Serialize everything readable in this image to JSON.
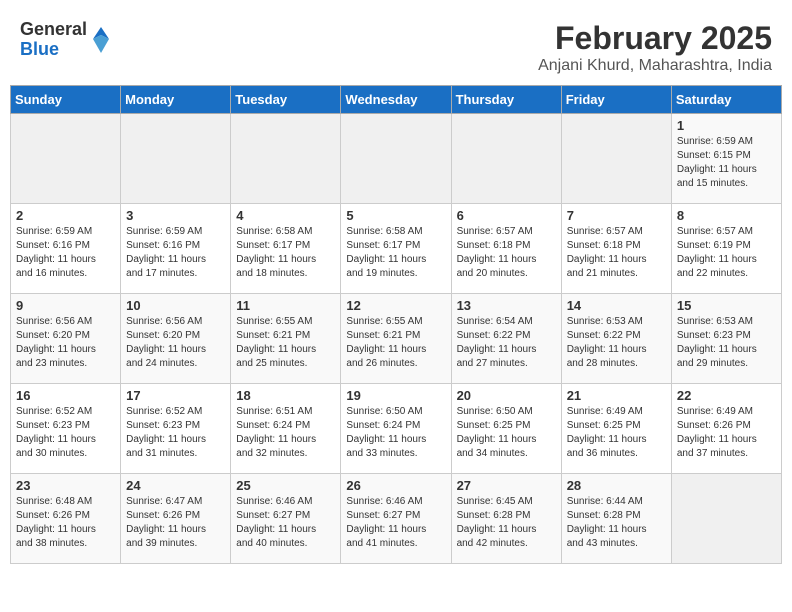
{
  "header": {
    "logo": {
      "general": "General",
      "blue": "Blue"
    },
    "title": "February 2025",
    "subtitle": "Anjani Khurd, Maharashtra, India"
  },
  "weekdays": [
    "Sunday",
    "Monday",
    "Tuesday",
    "Wednesday",
    "Thursday",
    "Friday",
    "Saturday"
  ],
  "weeks": [
    [
      {
        "day": "",
        "info": ""
      },
      {
        "day": "",
        "info": ""
      },
      {
        "day": "",
        "info": ""
      },
      {
        "day": "",
        "info": ""
      },
      {
        "day": "",
        "info": ""
      },
      {
        "day": "",
        "info": ""
      },
      {
        "day": "1",
        "info": "Sunrise: 6:59 AM\nSunset: 6:15 PM\nDaylight: 11 hours\nand 15 minutes."
      }
    ],
    [
      {
        "day": "2",
        "info": "Sunrise: 6:59 AM\nSunset: 6:16 PM\nDaylight: 11 hours\nand 16 minutes."
      },
      {
        "day": "3",
        "info": "Sunrise: 6:59 AM\nSunset: 6:16 PM\nDaylight: 11 hours\nand 17 minutes."
      },
      {
        "day": "4",
        "info": "Sunrise: 6:58 AM\nSunset: 6:17 PM\nDaylight: 11 hours\nand 18 minutes."
      },
      {
        "day": "5",
        "info": "Sunrise: 6:58 AM\nSunset: 6:17 PM\nDaylight: 11 hours\nand 19 minutes."
      },
      {
        "day": "6",
        "info": "Sunrise: 6:57 AM\nSunset: 6:18 PM\nDaylight: 11 hours\nand 20 minutes."
      },
      {
        "day": "7",
        "info": "Sunrise: 6:57 AM\nSunset: 6:18 PM\nDaylight: 11 hours\nand 21 minutes."
      },
      {
        "day": "8",
        "info": "Sunrise: 6:57 AM\nSunset: 6:19 PM\nDaylight: 11 hours\nand 22 minutes."
      }
    ],
    [
      {
        "day": "9",
        "info": "Sunrise: 6:56 AM\nSunset: 6:20 PM\nDaylight: 11 hours\nand 23 minutes."
      },
      {
        "day": "10",
        "info": "Sunrise: 6:56 AM\nSunset: 6:20 PM\nDaylight: 11 hours\nand 24 minutes."
      },
      {
        "day": "11",
        "info": "Sunrise: 6:55 AM\nSunset: 6:21 PM\nDaylight: 11 hours\nand 25 minutes."
      },
      {
        "day": "12",
        "info": "Sunrise: 6:55 AM\nSunset: 6:21 PM\nDaylight: 11 hours\nand 26 minutes."
      },
      {
        "day": "13",
        "info": "Sunrise: 6:54 AM\nSunset: 6:22 PM\nDaylight: 11 hours\nand 27 minutes."
      },
      {
        "day": "14",
        "info": "Sunrise: 6:53 AM\nSunset: 6:22 PM\nDaylight: 11 hours\nand 28 minutes."
      },
      {
        "day": "15",
        "info": "Sunrise: 6:53 AM\nSunset: 6:23 PM\nDaylight: 11 hours\nand 29 minutes."
      }
    ],
    [
      {
        "day": "16",
        "info": "Sunrise: 6:52 AM\nSunset: 6:23 PM\nDaylight: 11 hours\nand 30 minutes."
      },
      {
        "day": "17",
        "info": "Sunrise: 6:52 AM\nSunset: 6:23 PM\nDaylight: 11 hours\nand 31 minutes."
      },
      {
        "day": "18",
        "info": "Sunrise: 6:51 AM\nSunset: 6:24 PM\nDaylight: 11 hours\nand 32 minutes."
      },
      {
        "day": "19",
        "info": "Sunrise: 6:50 AM\nSunset: 6:24 PM\nDaylight: 11 hours\nand 33 minutes."
      },
      {
        "day": "20",
        "info": "Sunrise: 6:50 AM\nSunset: 6:25 PM\nDaylight: 11 hours\nand 34 minutes."
      },
      {
        "day": "21",
        "info": "Sunrise: 6:49 AM\nSunset: 6:25 PM\nDaylight: 11 hours\nand 36 minutes."
      },
      {
        "day": "22",
        "info": "Sunrise: 6:49 AM\nSunset: 6:26 PM\nDaylight: 11 hours\nand 37 minutes."
      }
    ],
    [
      {
        "day": "23",
        "info": "Sunrise: 6:48 AM\nSunset: 6:26 PM\nDaylight: 11 hours\nand 38 minutes."
      },
      {
        "day": "24",
        "info": "Sunrise: 6:47 AM\nSunset: 6:26 PM\nDaylight: 11 hours\nand 39 minutes."
      },
      {
        "day": "25",
        "info": "Sunrise: 6:46 AM\nSunset: 6:27 PM\nDaylight: 11 hours\nand 40 minutes."
      },
      {
        "day": "26",
        "info": "Sunrise: 6:46 AM\nSunset: 6:27 PM\nDaylight: 11 hours\nand 41 minutes."
      },
      {
        "day": "27",
        "info": "Sunrise: 6:45 AM\nSunset: 6:28 PM\nDaylight: 11 hours\nand 42 minutes."
      },
      {
        "day": "28",
        "info": "Sunrise: 6:44 AM\nSunset: 6:28 PM\nDaylight: 11 hours\nand 43 minutes."
      },
      {
        "day": "",
        "info": ""
      }
    ]
  ]
}
